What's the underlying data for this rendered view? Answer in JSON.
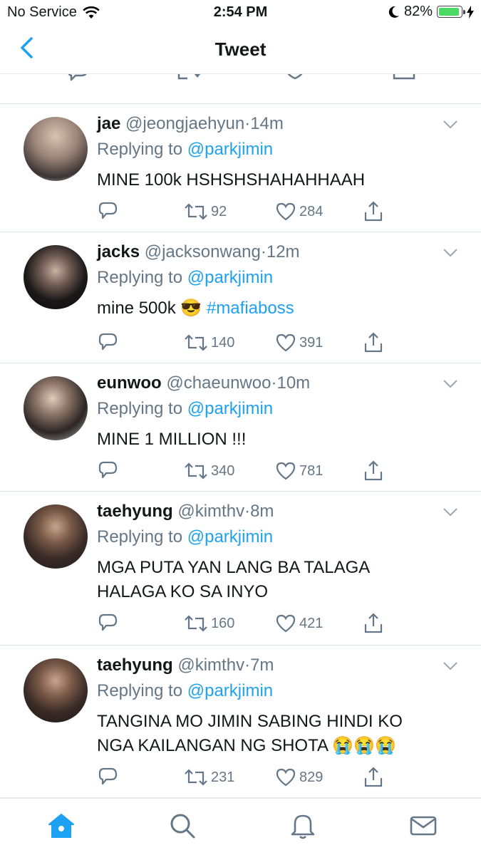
{
  "status_bar": {
    "carrier": "No Service",
    "time": "2:54 PM",
    "battery": "82%"
  },
  "nav": {
    "title": "Tweet",
    "back_icon": "chevron-left-icon"
  },
  "colors": {
    "accent": "#1da1f2",
    "muted": "#657786",
    "text": "#14171a",
    "battery_fill": "#4cd964"
  },
  "tweets": [
    {
      "name": "jae",
      "handle": "@jeongjaehyun",
      "time": "14m",
      "replying_to": "Replying to",
      "mention": "@parkjimin",
      "text": "MINE 100k HSHSHSHAHAHHAAH",
      "retweets": "92",
      "likes": "284"
    },
    {
      "name": "jacks",
      "handle": "@jacksonwang",
      "time": "12m",
      "replying_to": "Replying to",
      "mention": "@parkjimin",
      "text": "mine 500k",
      "emoji": "😎",
      "hashtag": "#mafiaboss",
      "retweets": "140",
      "likes": "391"
    },
    {
      "name": "eunwoo",
      "handle": "@chaeunwoo",
      "time": "10m",
      "replying_to": "Replying to",
      "mention": "@parkjimin",
      "text": "MINE 1 MILLION !!!",
      "retweets": "340",
      "likes": "781"
    },
    {
      "name": "taehyung",
      "handle": "@kimthv",
      "time": "8m",
      "replying_to": "Replying to",
      "mention": "@parkjimin",
      "text": "MGA PUTA YAN LANG BA TALAGA HALAGA KO SA INYO",
      "retweets": "160",
      "likes": "421"
    },
    {
      "name": "taehyung",
      "handle": "@kimthv",
      "time": "7m",
      "replying_to": "Replying to",
      "mention": "@parkjimin",
      "text": "TANGINA MO JIMIN SABING HINDI KO NGA KAILANGAN NG SHOTA",
      "emoji": "😭😭😭",
      "retweets": "231",
      "likes": "829"
    }
  ],
  "tab_bar": {
    "items": [
      "home-icon",
      "search-icon",
      "notifications-icon",
      "messages-icon"
    ],
    "active": "home-icon"
  }
}
